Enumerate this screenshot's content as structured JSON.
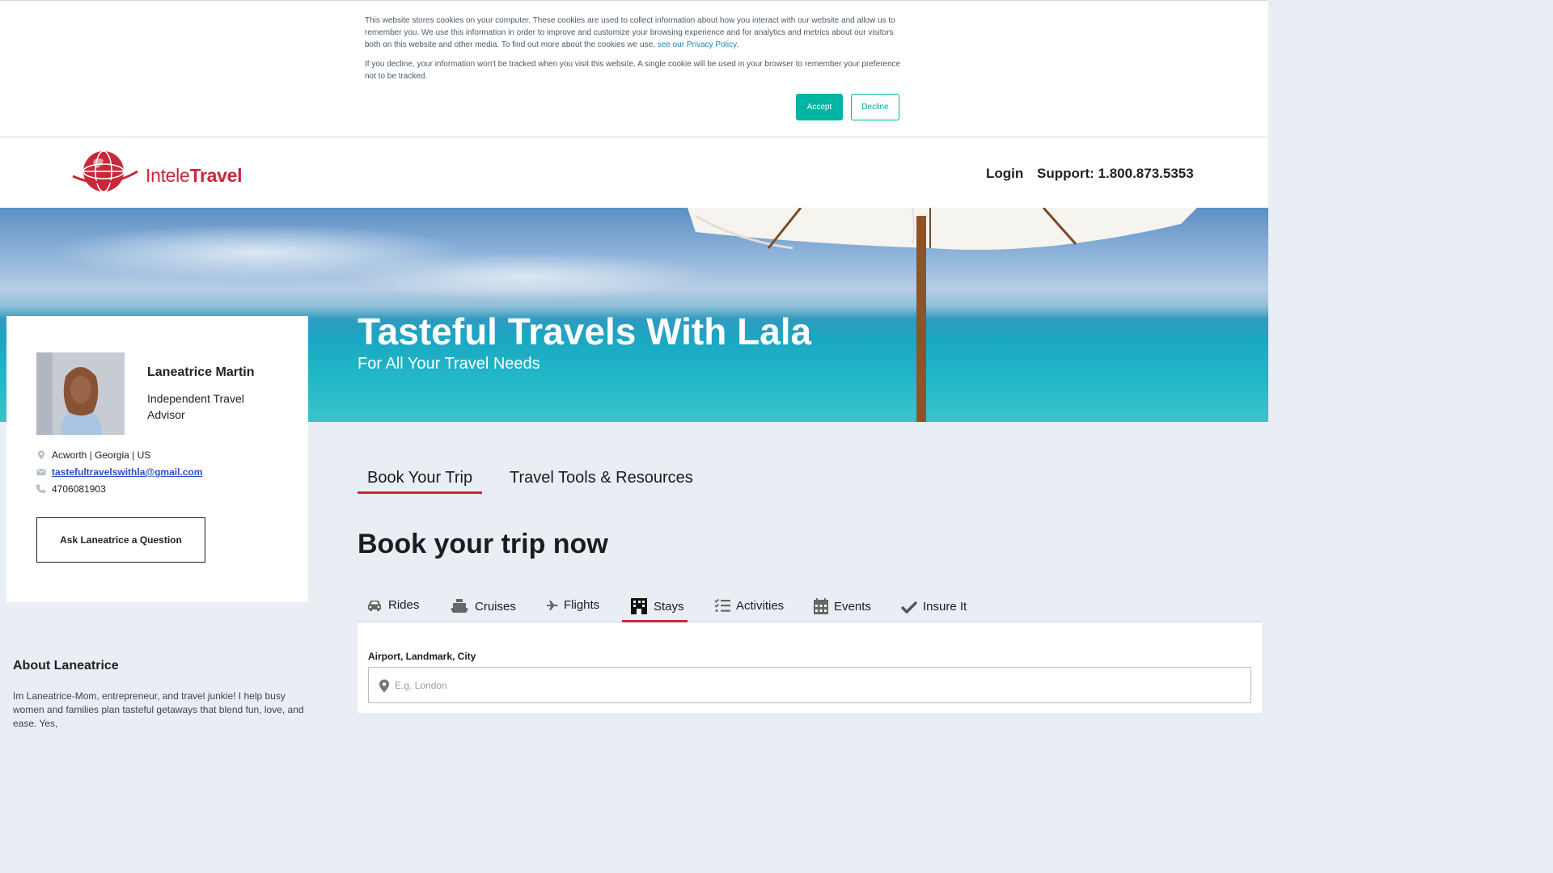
{
  "cookie": {
    "text1": "This website stores cookies on your computer. These cookies are used to collect information about how you interact with our website and allow us to remember you. We use this information in order to improve and customize your browsing experience and for analytics and metrics about our visitors both on this website and other media. To find out more about the cookies we use, ",
    "link": "see our Privacy Policy",
    "text1_end": ".",
    "text2": "If you decline, your information won't be tracked when you visit this website. A single cookie will be used in your browser to remember your preference not to be tracked.",
    "accept": "Accept",
    "decline": "Decline"
  },
  "header": {
    "logo_part1": "Intele",
    "logo_part2": "Travel",
    "login": "Login",
    "support": "Support: 1.800.873.5353"
  },
  "hero": {
    "title": "Tasteful Travels With Lala",
    "subtitle": "For All Your Travel Needs"
  },
  "profile": {
    "name": "Laneatrice Martin",
    "title": "Independent Travel Advisor",
    "location": "Acworth | Georgia | US",
    "email": "tastefultravelswithla@gmail.com",
    "phone": "4706081903",
    "ask_button": "Ask Laneatrice a Question"
  },
  "about": {
    "heading": "About Laneatrice",
    "text": "Im Laneatrice-Mom, entrepreneur, and travel junkie! I help busy women and families plan tasteful getaways that blend fun, love, and ease. Yes,"
  },
  "main_tabs": [
    {
      "label": "Book Your Trip",
      "active": true
    },
    {
      "label": "Travel Tools & Resources",
      "active": false
    }
  ],
  "booking": {
    "heading": "Book your trip now",
    "services": [
      {
        "label": "Rides",
        "icon": "car-icon"
      },
      {
        "label": "Cruises",
        "icon": "ship-icon"
      },
      {
        "label": "Flights",
        "icon": "plane-icon"
      },
      {
        "label": "Stays",
        "icon": "hotel-icon",
        "active": true
      },
      {
        "label": "Activities",
        "icon": "list-check-icon"
      },
      {
        "label": "Events",
        "icon": "calendar-icon"
      },
      {
        "label": "Insure It",
        "icon": "checkmark-icon"
      }
    ],
    "field_label": "Airport, Landmark, City",
    "field_placeholder": "E.g. London"
  },
  "colors": {
    "accent": "#c8283a",
    "accept_button": "#00b5a3",
    "link": "#2d4fc9"
  }
}
